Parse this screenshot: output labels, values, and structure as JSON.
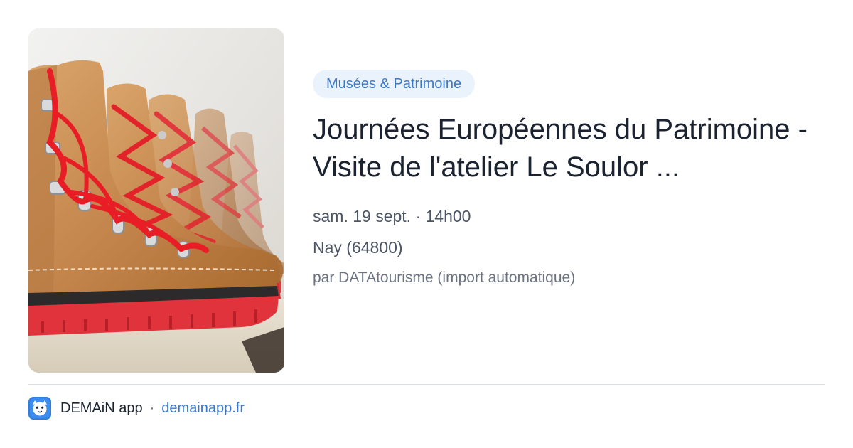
{
  "event": {
    "category": "Musées & Patrimoine",
    "title": "Journées Européennes du Patrimoine - Visite de l'atelier Le Soulor ...",
    "datetime": "sam. 19 sept. · 14h00",
    "location": "Nay (64800)",
    "source": "par DATAtourisme (import automatique)",
    "image_icon": "hiking-boots-photo"
  },
  "footer": {
    "app_name": "DEMAiN app",
    "separator": "·",
    "url": "demainapp.fr",
    "logo_icon": "demain-app-logo-icon"
  },
  "colors": {
    "accent": "#3a78c9",
    "chip_bg": "#eaf2fc",
    "title": "#1b2230",
    "meta": "#4c5565",
    "divider": "#dde2e7"
  }
}
